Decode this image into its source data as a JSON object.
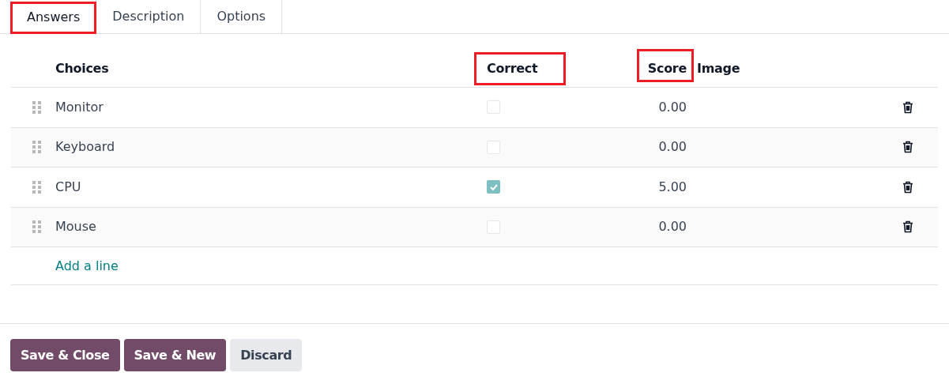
{
  "tabs": [
    {
      "label": "Answers",
      "selected": true,
      "highlighted": true
    },
    {
      "label": "Description",
      "selected": false,
      "highlighted": false
    },
    {
      "label": "Options",
      "selected": false,
      "highlighted": false
    }
  ],
  "table": {
    "columns": [
      {
        "label": "Choices",
        "highlighted": false
      },
      {
        "label": "Correct",
        "highlighted": true
      },
      {
        "label": "Score",
        "highlighted": true
      },
      {
        "label": "Image",
        "highlighted": false
      }
    ],
    "rows": [
      {
        "choice": "Monitor",
        "correct": false,
        "score": "0.00"
      },
      {
        "choice": "Keyboard",
        "correct": false,
        "score": "0.00"
      },
      {
        "choice": "CPU",
        "correct": true,
        "score": "5.00"
      },
      {
        "choice": "Mouse",
        "correct": false,
        "score": "0.00"
      }
    ],
    "add_line": "Add a line"
  },
  "buttons": [
    {
      "label": "Save & Close",
      "kind": "primary"
    },
    {
      "label": "Save & New",
      "kind": "primary"
    },
    {
      "label": "Discard",
      "kind": "secondary"
    }
  ]
}
